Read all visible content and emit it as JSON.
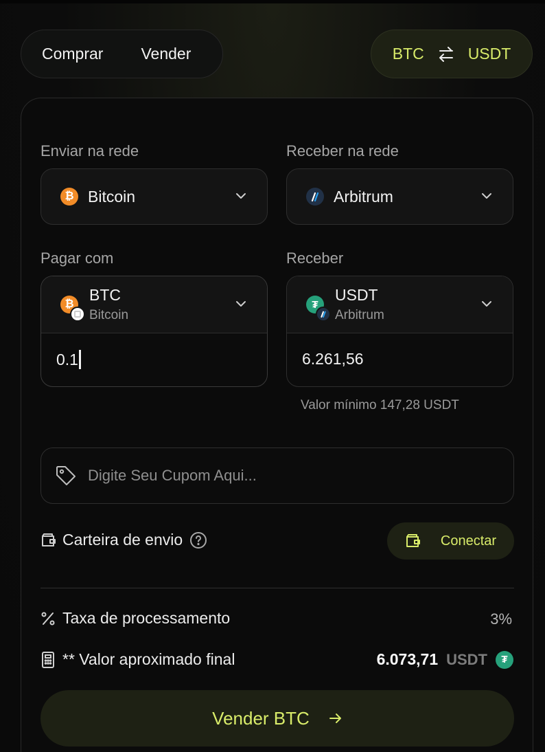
{
  "header": {
    "buy_label": "Comprar",
    "sell_label": "Vender",
    "pair_from": "BTC",
    "pair_to": "USDT"
  },
  "send_network": {
    "label": "Enviar na rede",
    "value": "Bitcoin",
    "icon": "bitcoin-icon"
  },
  "receive_network": {
    "label": "Receber na rede",
    "value": "Arbitrum",
    "icon": "arbitrum-icon"
  },
  "pay": {
    "label": "Pagar com",
    "token": "BTC",
    "network": "Bitcoin",
    "amount": "0.1"
  },
  "receive": {
    "label": "Receber",
    "token": "USDT",
    "network": "Arbitrum",
    "amount": "6.261,56",
    "min_text": "Valor mínimo 147,28 USDT"
  },
  "coupon": {
    "placeholder": "Digite Seu Cupom Aqui..."
  },
  "wallet": {
    "label": "Carteira de envio",
    "connect_label": "Conectar"
  },
  "fee": {
    "label": "Taxa de processamento",
    "value": "3%"
  },
  "final": {
    "label": "** Valor aproximado final",
    "value": "6.073,71",
    "unit": "USDT"
  },
  "submit": {
    "label": "Vender BTC"
  },
  "colors": {
    "accent": "#d9ec6a",
    "accent_bg": "#1e2114",
    "bitcoin": "#f28c28",
    "tether": "#26a17b",
    "arbitrum": "#213147"
  }
}
